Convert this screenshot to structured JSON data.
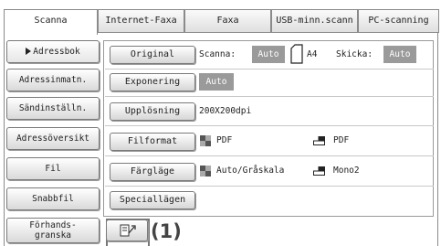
{
  "tabs": [
    {
      "label": "Scanna",
      "active": true
    },
    {
      "label": "Internet-Faxa",
      "active": false
    },
    {
      "label": "Faxa",
      "active": false
    },
    {
      "label": "USB-minn.scann",
      "active": false
    },
    {
      "label": "PC-scanning",
      "active": false
    }
  ],
  "sidebar": {
    "items": [
      {
        "label": "Adressbok",
        "selected": true
      },
      {
        "label": "Adressinmatn."
      },
      {
        "label": "Sändinställn."
      },
      {
        "label": "Adressöversikt"
      },
      {
        "label": "Fil"
      },
      {
        "label": "Snabbfil"
      },
      {
        "label_line1": "Förhands-",
        "label_line2": "granska"
      }
    ]
  },
  "settings": {
    "original": {
      "button": "Original",
      "scan_label": "Scanna:",
      "scan_value": "Auto",
      "paper_size": "A4",
      "send_label": "Skicka:",
      "send_value": "Auto"
    },
    "exposure": {
      "button": "Exponering",
      "value": "Auto"
    },
    "resolution": {
      "button": "Upplösning",
      "value": "200X200dpi"
    },
    "file_format": {
      "button": "Filformat",
      "color_value": "PDF",
      "mono_value": "PDF"
    },
    "color_mode": {
      "button": "Färgläge",
      "color_value": "Auto/Gråskala",
      "mono_value": "Mono2"
    },
    "special": {
      "button": "Speciallägen"
    }
  },
  "preview": {
    "callout": "(1)",
    "icon": "preview-scan-icon"
  },
  "colors": {
    "badge": "#9a9a9a",
    "border": "#8a8a8a"
  }
}
